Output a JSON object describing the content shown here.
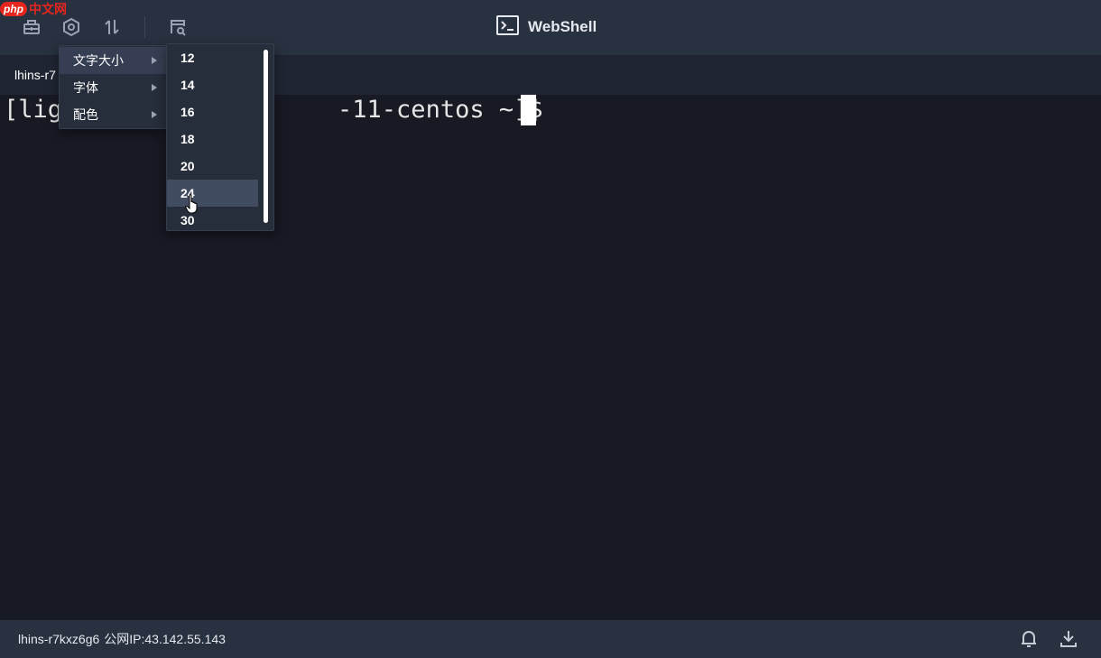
{
  "watermark": {
    "badge": "php",
    "text": "中文网"
  },
  "toolbar": {
    "icons": [
      "session-icon",
      "settings-icon",
      "transfer-icon",
      "file-manager-icon"
    ]
  },
  "title": {
    "text": "WebShell",
    "icon": "terminal-icon"
  },
  "tab": {
    "label": "lhins-r7"
  },
  "terminal": {
    "prompt_left": "[lig",
    "prompt_right": "-11-centos ~]$ "
  },
  "settings_menu": {
    "items": [
      {
        "label": "文字大小",
        "active": true
      },
      {
        "label": "字体",
        "active": false
      },
      {
        "label": "配色",
        "active": false
      }
    ]
  },
  "font_size_submenu": {
    "options": [
      "12",
      "14",
      "16",
      "18",
      "20",
      "24",
      "30"
    ],
    "hovered": "24"
  },
  "status": {
    "instance": "lhins-r7kxz6g6",
    "ip_label": "公网IP:",
    "ip": "43.142.55.143"
  },
  "colors": {
    "topbar": "#283140",
    "terminal_bg": "#171923",
    "menu_bg": "#262d3b",
    "menu_hover": "#414c60"
  }
}
